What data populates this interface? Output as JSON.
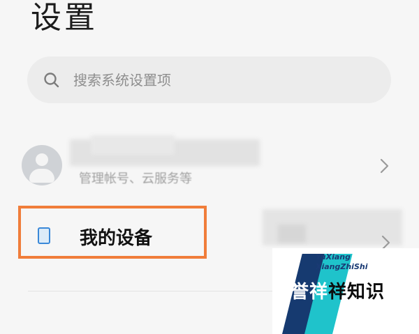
{
  "header": {
    "title": "设置"
  },
  "search": {
    "placeholder": "搜索系统设置项",
    "icon": "search-icon"
  },
  "account": {
    "subtitle": "管理帐号、云服务等",
    "icon": "avatar-icon"
  },
  "device": {
    "label": "我的设备",
    "icon": "phone-icon",
    "highlight_color": "#f07d3a"
  },
  "watermark": {
    "en_line1": "YuXiang",
    "en_line2": "XiangZhiShi",
    "zh_part1": "誉",
    "zh_part2": "祥",
    "zh_part3": "祥知识"
  },
  "colors": {
    "background": "#f6f6f6",
    "search_bg": "#ececec",
    "device_icon": "#3a88d8"
  }
}
